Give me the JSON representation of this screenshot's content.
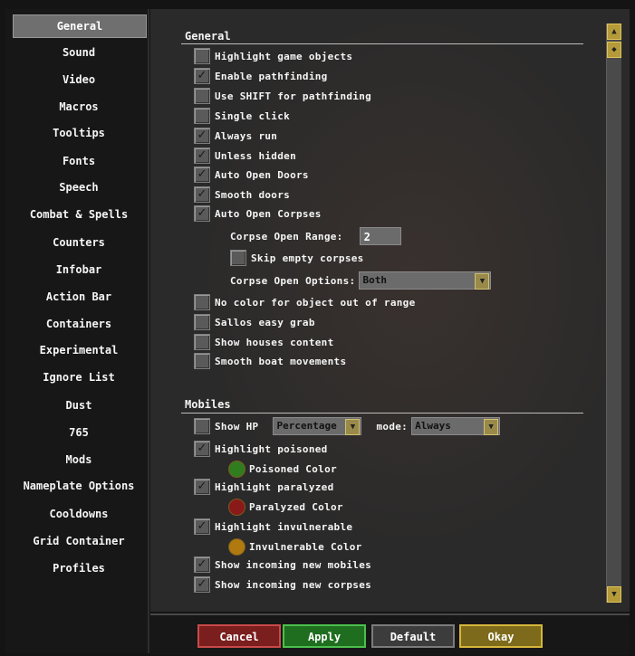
{
  "sidebar": {
    "items": [
      {
        "label": "General",
        "active": true
      },
      {
        "label": "Sound"
      },
      {
        "label": "Video"
      },
      {
        "label": "Macros"
      },
      {
        "label": "Tooltips"
      },
      {
        "label": "Fonts"
      },
      {
        "label": "Speech"
      },
      {
        "label": "Combat & Spells"
      },
      {
        "label": "Counters"
      },
      {
        "label": "Infobar"
      },
      {
        "label": "Action Bar"
      },
      {
        "label": "Containers"
      },
      {
        "label": "Experimental"
      },
      {
        "label": "Ignore List"
      },
      {
        "label": "Dust"
      },
      {
        "label": "765"
      },
      {
        "label": "Mods"
      },
      {
        "label": "Nameplate Options"
      },
      {
        "label": "Cooldowns"
      },
      {
        "label": "Grid Container"
      },
      {
        "label": "Profiles"
      }
    ]
  },
  "general": {
    "title": "General",
    "highlight_game_objects": {
      "label": "Highlight game objects",
      "checked": false
    },
    "enable_pathfinding": {
      "label": "Enable pathfinding",
      "checked": true
    },
    "use_shift_pathfinding": {
      "label": "Use SHIFT for pathfinding",
      "checked": false
    },
    "single_click": {
      "label": "Single click",
      "checked": false
    },
    "always_run": {
      "label": "Always run",
      "checked": true
    },
    "unless_hidden": {
      "label": "Unless hidden",
      "checked": true
    },
    "auto_open_doors": {
      "label": "Auto Open Doors",
      "checked": true
    },
    "smooth_doors": {
      "label": "Smooth doors",
      "checked": true
    },
    "auto_open_corpses": {
      "label": "Auto Open Corpses",
      "checked": true
    },
    "corpse_open_range": {
      "label": "Corpse Open Range:",
      "value": "2"
    },
    "skip_empty_corpses": {
      "label": "Skip empty corpses",
      "checked": false
    },
    "corpse_open_options": {
      "label": "Corpse Open Options:",
      "value": "Both"
    },
    "no_color_out_of_range": {
      "label": "No color for object out of range",
      "checked": false
    },
    "sallos_easy_grab": {
      "label": "Sallos easy grab",
      "checked": false
    },
    "show_houses_content": {
      "label": "Show houses content",
      "checked": false
    },
    "smooth_boat_movements": {
      "label": "Smooth boat movements",
      "checked": false
    }
  },
  "mobiles": {
    "title": "Mobiles",
    "show_hp": {
      "label": "Show HP",
      "checked": false,
      "type_value": "Percentage",
      "mode_label": "mode:",
      "mode_value": "Always"
    },
    "highlight_poisoned": {
      "label": "Highlight poisoned",
      "checked": true
    },
    "poisoned_color": {
      "label": "Poisoned Color",
      "color": "#2f7d1f"
    },
    "highlight_paralyzed": {
      "label": "Highlight paralyzed",
      "checked": true
    },
    "paralyzed_color": {
      "label": "Paralyzed Color",
      "color": "#8a1a1a"
    },
    "highlight_invulnerable": {
      "label": "Highlight invulnerable",
      "checked": true
    },
    "invulnerable_color": {
      "label": "Invulnerable Color",
      "color": "#b07a10"
    },
    "show_incoming_mobiles": {
      "label": "Show incoming new mobiles",
      "checked": true
    },
    "show_incoming_corpses": {
      "label": "Show incoming new corpses",
      "checked": true
    }
  },
  "footer": {
    "cancel": "Cancel",
    "apply": "Apply",
    "default": "Default",
    "okay": "Okay"
  },
  "icons": {
    "check": "✓",
    "arrow_down": "▼",
    "arrow_up": "▲"
  }
}
